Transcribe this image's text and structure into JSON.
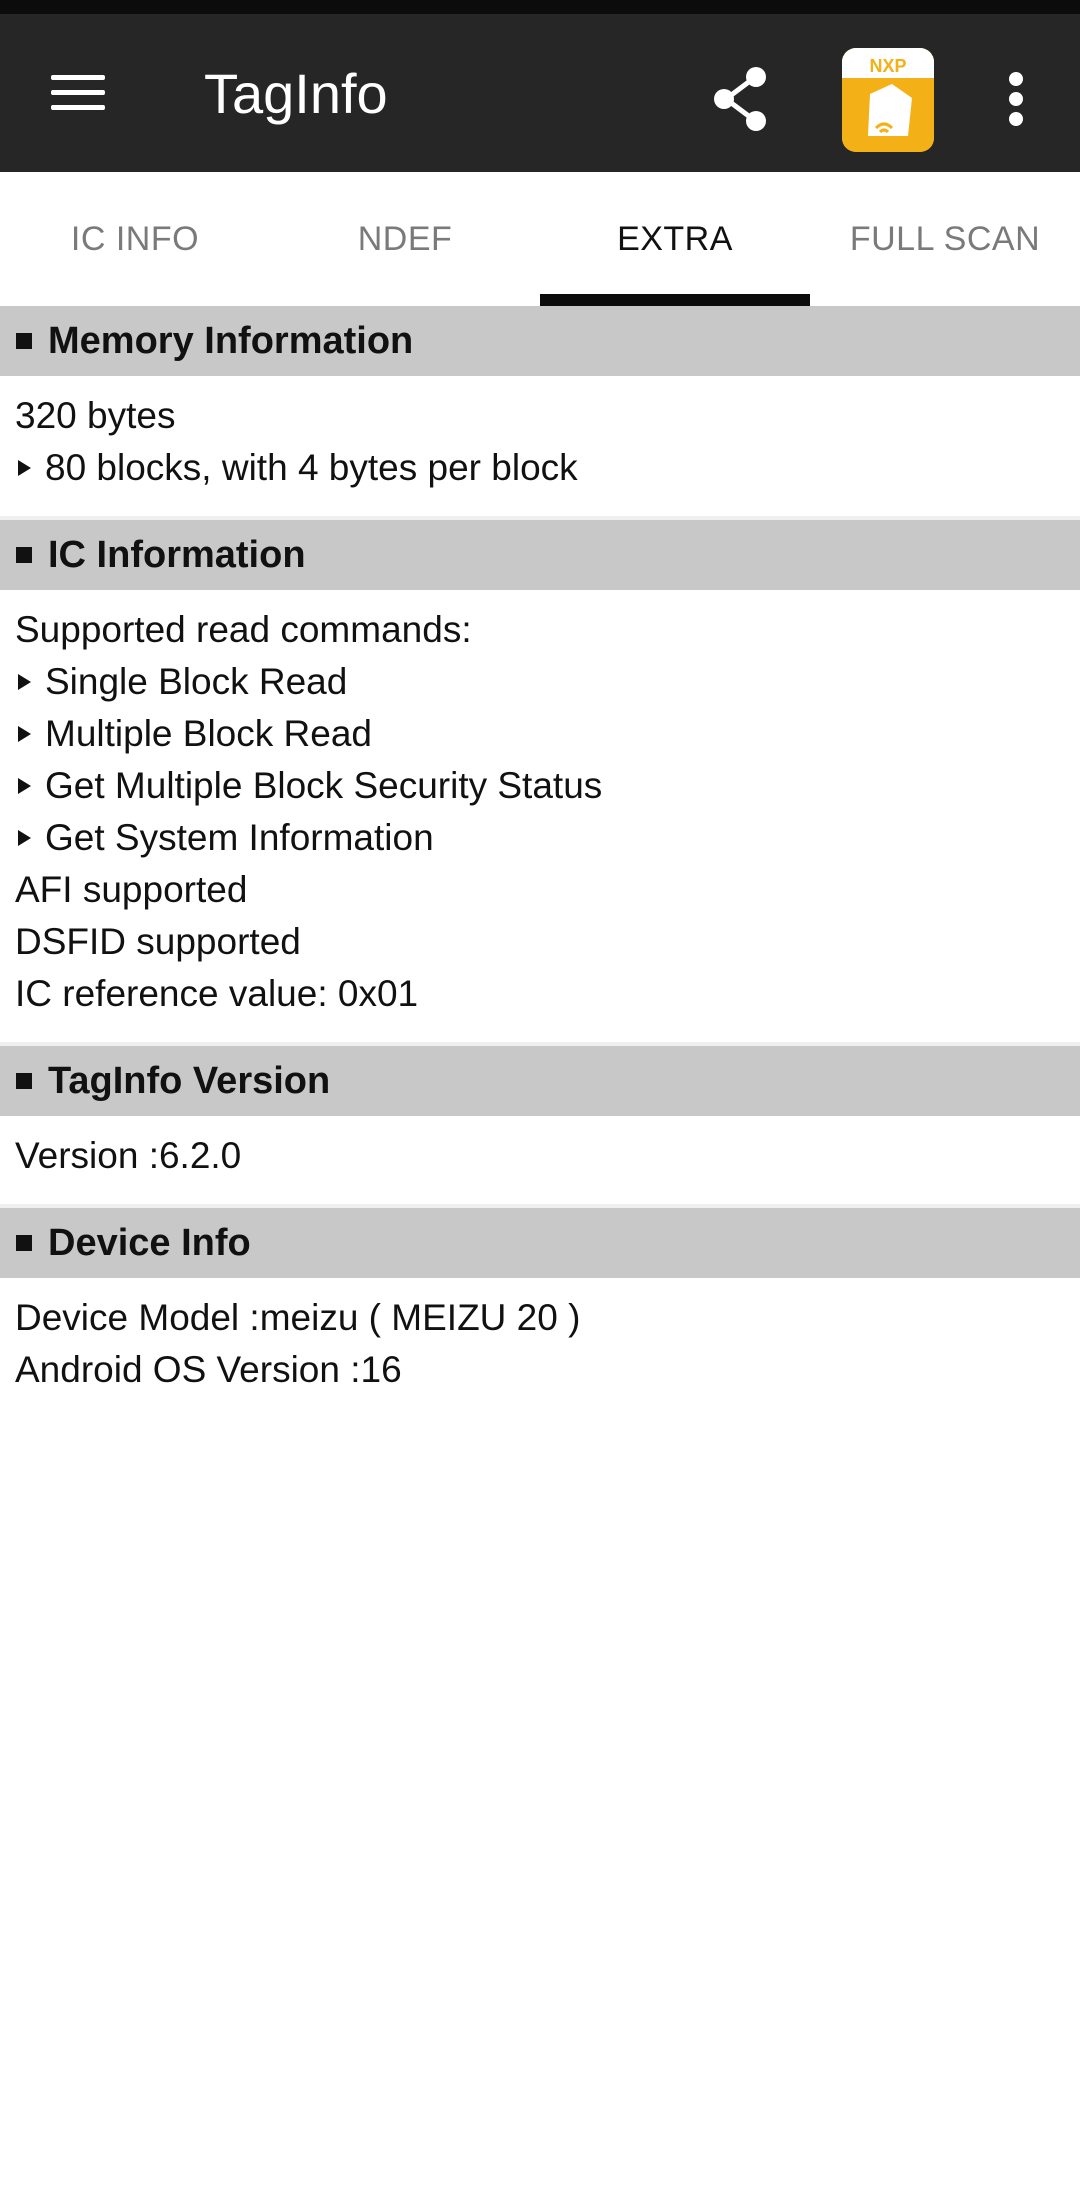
{
  "app_bar": {
    "title": "TagInfo",
    "icons": {
      "menu": "hamburger-menu-icon",
      "share": "share-icon",
      "logo": "nxp-taginfo-logo",
      "overflow": "more-vert-icon"
    },
    "logo_text": "NXP",
    "colors": {
      "bar": "#262626",
      "logo_bg": "#f4b117"
    }
  },
  "tabs": [
    {
      "label": "IC INFO",
      "active": false
    },
    {
      "label": "NDEF",
      "active": false
    },
    {
      "label": "EXTRA",
      "active": true
    },
    {
      "label": "FULL SCAN",
      "active": false
    }
  ],
  "sections": [
    {
      "title": "Memory Information",
      "lines": [
        {
          "text": "320 bytes",
          "bullet": false
        },
        {
          "text": "80 blocks, with 4 bytes per block",
          "bullet": true
        }
      ]
    },
    {
      "title": "IC Information",
      "lines": [
        {
          "text": "Supported read commands:",
          "bullet": false
        },
        {
          "text": "Single Block Read",
          "bullet": true
        },
        {
          "text": "Multiple Block Read",
          "bullet": true
        },
        {
          "text": "Get Multiple Block Security Status",
          "bullet": true
        },
        {
          "text": "Get System Information",
          "bullet": true
        },
        {
          "text": "AFI supported",
          "bullet": false
        },
        {
          "text": "DSFID supported",
          "bullet": false
        },
        {
          "text": "IC reference value: 0x01",
          "bullet": false
        }
      ]
    },
    {
      "title": "TagInfo Version",
      "lines": [
        {
          "text": "Version :6.2.0",
          "bullet": false
        }
      ]
    },
    {
      "title": "Device Info",
      "lines": [
        {
          "text": "Device Model :meizu ( MEIZU 20 )",
          "bullet": false
        },
        {
          "text": "Android OS Version :16",
          "bullet": false
        }
      ]
    }
  ]
}
